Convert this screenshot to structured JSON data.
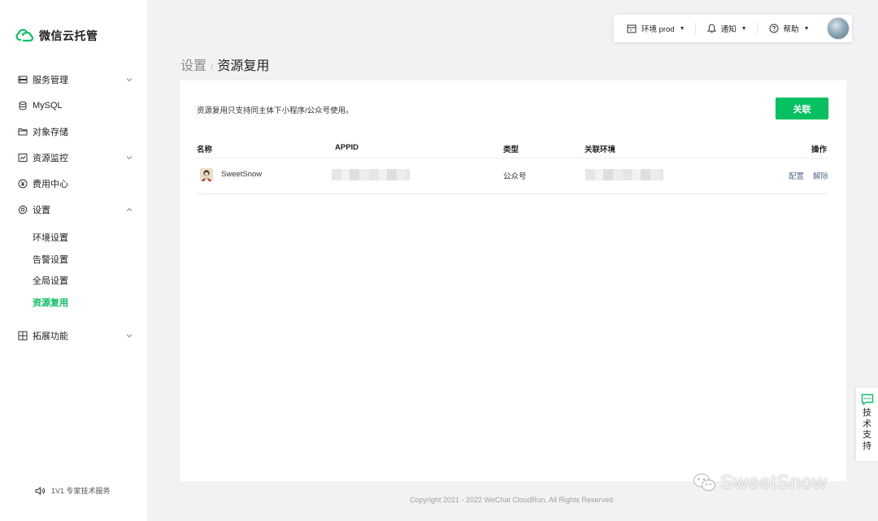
{
  "app": {
    "title": "微信云托管"
  },
  "sidebar": {
    "items": [
      {
        "label": "服务管理",
        "icon": "server-icon",
        "expandable": true,
        "expanded": false
      },
      {
        "label": "MySQL",
        "icon": "database-icon",
        "expandable": false
      },
      {
        "label": "对象存储",
        "icon": "folder-icon",
        "expandable": false
      },
      {
        "label": "资源监控",
        "icon": "monitor-icon",
        "expandable": true,
        "expanded": false
      },
      {
        "label": "费用中心",
        "icon": "yuan-icon",
        "expandable": false
      },
      {
        "label": "设置",
        "icon": "gear-icon",
        "expandable": true,
        "expanded": true
      },
      {
        "label": "拓展功能",
        "icon": "grid-icon",
        "expandable": true,
        "expanded": false
      }
    ],
    "settings_sub": [
      {
        "label": "环境设置",
        "active": false
      },
      {
        "label": "告警设置",
        "active": false
      },
      {
        "label": "全局设置",
        "active": false
      },
      {
        "label": "资源复用",
        "active": true
      }
    ],
    "support_label": "1V1 专家技术服务"
  },
  "topbar": {
    "env_label": "环境 prod",
    "notify_label": "通知",
    "help_label": "帮助"
  },
  "breadcrumb": {
    "parent": "设置",
    "separator": "/",
    "current": "资源复用"
  },
  "content": {
    "description": "资源复用只支持同主体下小程序/公众号使用。",
    "link_button": "关联",
    "table": {
      "headers": {
        "name": "名称",
        "appid": "APPID",
        "type": "类型",
        "env": "关联环境",
        "ops": "操作"
      },
      "rows": [
        {
          "name": "SweetSnow",
          "type": "公众号",
          "op_config": "配置",
          "op_unlink": "解除"
        }
      ]
    }
  },
  "footer": "Copyright 2021 - 2022 WeChat CloudRun. All Rights Reserved",
  "support_tab": {
    "label": "技术支持"
  },
  "watermark": "SweetSnow",
  "colors": {
    "accent": "#07c160",
    "link": "#576b95",
    "background": "#f2f2f3"
  }
}
